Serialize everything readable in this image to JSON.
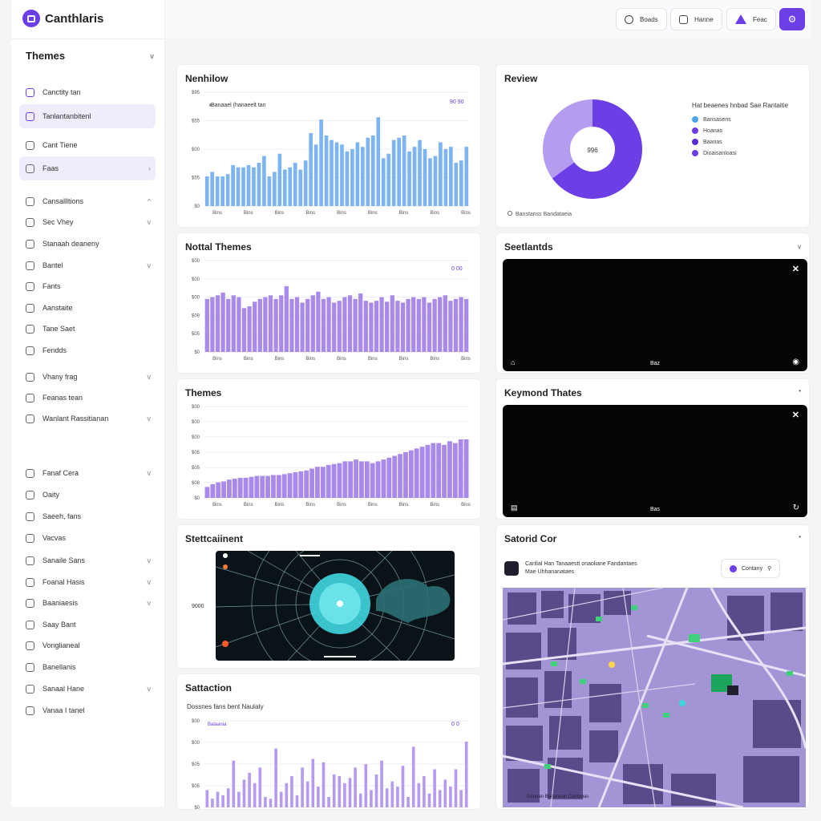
{
  "app": {
    "name": "Canthlaris"
  },
  "topbar": {
    "btn1": "Boads",
    "btn2": "Hanne",
    "btn3": "Feac",
    "primary_icon": "settings-icon"
  },
  "sidebar": {
    "section_title": "Themes",
    "items": [
      {
        "label": "Canctity tan",
        "icon": "document-icon",
        "chevron": ""
      },
      {
        "label": "Tanlantanbitenl",
        "icon": "calendar-icon",
        "chevron": ""
      },
      {
        "label": "Cant Tiene",
        "icon": "folder-icon",
        "chevron": ""
      },
      {
        "label": "Faas",
        "icon": "folder-icon",
        "chevron": "›"
      },
      {
        "label": "Cansallltions",
        "icon": "list-icon",
        "chevron": "^"
      },
      {
        "label": "Sec Vhey",
        "icon": "file-icon",
        "chevron": "v"
      },
      {
        "label": "Stanaah deaneny",
        "icon": "file-icon",
        "chevron": ""
      },
      {
        "label": "Bantel",
        "icon": "search-icon",
        "chevron": "v"
      },
      {
        "label": "Fants",
        "icon": "file-icon",
        "chevron": ""
      },
      {
        "label": "Aanstaite",
        "icon": "face-icon",
        "chevron": ""
      },
      {
        "label": "Tane Saet",
        "icon": "box-icon",
        "chevron": ""
      },
      {
        "label": "Fendds",
        "icon": "chat-icon",
        "chevron": ""
      },
      {
        "label": "Vhany frag",
        "icon": "file-icon",
        "chevron": "v"
      },
      {
        "label": "Feanas tean",
        "icon": "box-icon",
        "chevron": ""
      },
      {
        "label": "Wanlant Rassitianan",
        "icon": "list-icon",
        "chevron": "v"
      },
      {
        "label": "Fanaf Cera",
        "icon": "file-icon",
        "chevron": "v"
      },
      {
        "label": "Oaity",
        "icon": "face-icon",
        "chevron": ""
      },
      {
        "label": "Saeeh, fans",
        "icon": "file-icon",
        "chevron": ""
      },
      {
        "label": "Vacvas",
        "icon": "chat-icon",
        "chevron": ""
      },
      {
        "label": "Sanaile Sans",
        "icon": "list-icon",
        "chevron": "v"
      },
      {
        "label": "Foanal Hasis",
        "icon": "file-icon",
        "chevron": "v"
      },
      {
        "label": "Baaniaesis",
        "icon": "list-icon",
        "chevron": "v"
      },
      {
        "label": "Saay Bant",
        "icon": "chat-icon",
        "chevron": ""
      },
      {
        "label": "Vonglianeal",
        "icon": "folder-icon",
        "chevron": ""
      },
      {
        "label": "Banellanis",
        "icon": "file-icon",
        "chevron": ""
      },
      {
        "label": "Sanaal Hane",
        "icon": "list-icon",
        "chevron": "v"
      },
      {
        "label": "Vanaa I tanel",
        "icon": "file-icon",
        "chevron": ""
      }
    ]
  },
  "panels": {
    "nenhilow": {
      "title": "Nenhilow",
      "legend": "Banaael (hanaeelt tan",
      "badge": "90 90",
      "yticks": [
        "$0",
        "$55",
        "$00",
        "$55",
        "$95"
      ],
      "xticks": [
        "Bins",
        "Bins",
        "Bins",
        "Bins",
        "Bins",
        "Bins",
        "Bins",
        "Bins",
        "Bins"
      ]
    },
    "nottal": {
      "title": "Nottal Themes",
      "badge": "0 00",
      "yticks": [
        "$0",
        "$05",
        "$09",
        "$00",
        "$00",
        "$00"
      ],
      "xticks": [
        "Bins",
        "Bins",
        "Bins",
        "Bins",
        "Bins",
        "Bins",
        "Bins",
        "Bins",
        "Bins"
      ]
    },
    "themes": {
      "title": "Themes",
      "yticks": [
        "$0",
        "$08",
        "$05",
        "$05",
        "$00",
        "$00",
        "$00"
      ],
      "xticks": [
        "Bins",
        "Bins",
        "Bins",
        "Bins",
        "Bins",
        "Bins",
        "Bins",
        "Bins",
        "Bins"
      ]
    },
    "settlement": {
      "title": "Stettcaiinent",
      "ylabel": "9000"
    },
    "satisfaction": {
      "title": "Sattaction",
      "subtitle": "Dossnes fans bent Naulaty",
      "legend": "Balaania",
      "badge": "0 0",
      "yticks": [
        "$0",
        "$05",
        "$05",
        "$00",
        "$00"
      ]
    },
    "review": {
      "title": "Review",
      "center": "996",
      "legend_title": "Hat beaenes hnbad Sae Rantaitie",
      "legend": [
        {
          "label": "Bansasens",
          "color": "#4ba3e8"
        },
        {
          "label": "Hoanas",
          "color": "#6b3ee6"
        },
        {
          "label": "Baanas",
          "color": "#5a2dd4"
        },
        {
          "label": "Dioaisanloasi",
          "color": "#6b3ee6"
        }
      ],
      "footer": "Banstanss Bandataeia"
    },
    "setted": {
      "title": "Seetlantds",
      "center": "Baz"
    },
    "keymond": {
      "title": "Keymond Thates",
      "center": "Bas"
    },
    "satorid": {
      "title": "Satorid Cor",
      "line1": "Canlial Han Tanaaestt onaoliane Fandantaes",
      "line2": "Mae Uhhananataes",
      "btn": "Contany",
      "map_caption": "Dannan Bananoan Cantanas"
    }
  },
  "chart_data": [
    {
      "type": "bar",
      "title": "Nenhilow",
      "values": [
        26,
        30,
        26,
        26,
        28,
        36,
        34,
        34,
        36,
        34,
        38,
        44,
        26,
        30,
        46,
        32,
        34,
        38,
        32,
        40,
        64,
        54,
        76,
        62,
        58,
        56,
        54,
        48,
        50,
        56,
        52,
        60,
        62,
        78,
        42,
        46,
        58,
        60,
        62,
        48,
        52,
        58,
        50,
        42,
        44,
        56,
        50,
        52,
        38,
        40,
        52
      ]
    },
    {
      "type": "bar",
      "title": "Nottal Themes",
      "values": [
        58,
        60,
        62,
        65,
        58,
        62,
        60,
        48,
        50,
        55,
        58,
        60,
        62,
        58,
        62,
        72,
        58,
        60,
        54,
        58,
        62,
        66,
        58,
        60,
        54,
        56,
        60,
        62,
        58,
        64,
        56,
        54,
        56,
        60,
        55,
        62,
        56,
        54,
        58,
        60,
        58,
        60,
        54,
        58,
        60,
        62,
        56,
        58,
        60,
        58
      ]
    },
    {
      "type": "bar",
      "title": "Themes",
      "values": [
        12,
        15,
        17,
        18,
        20,
        21,
        22,
        22,
        23,
        24,
        24,
        24,
        25,
        25,
        26,
        27,
        28,
        29,
        30,
        32,
        34,
        34,
        36,
        37,
        38,
        40,
        40,
        42,
        40,
        40,
        38,
        40,
        42,
        44,
        46,
        48,
        50,
        52,
        54,
        56,
        58,
        60,
        60,
        58,
        62,
        60,
        64,
        64
      ]
    },
    {
      "type": "bar",
      "title": "Sattaction",
      "values": [
        20,
        10,
        18,
        14,
        22,
        54,
        18,
        32,
        40,
        28,
        46,
        12,
        10,
        68,
        18,
        28,
        36,
        14,
        46,
        30,
        56,
        24,
        52,
        12,
        38,
        36,
        28,
        34,
        46,
        16,
        50,
        20,
        38,
        54,
        22,
        30,
        24,
        48,
        12,
        70,
        28,
        36,
        16,
        44,
        20,
        32,
        24,
        44,
        20,
        76
      ]
    },
    {
      "type": "pie",
      "title": "Review",
      "slices": [
        65,
        35
      ]
    }
  ]
}
